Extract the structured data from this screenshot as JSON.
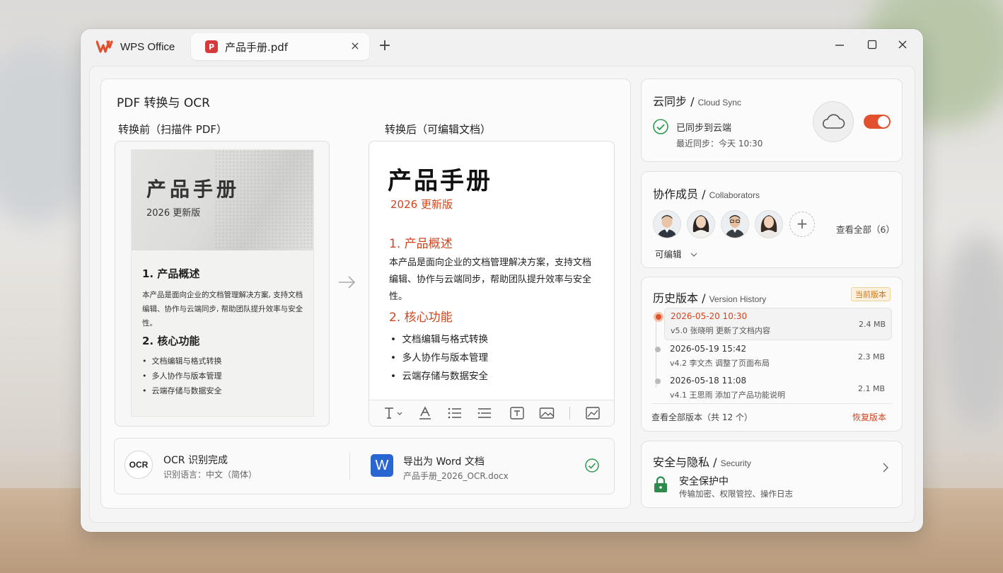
{
  "app": {
    "name": "WPS Office",
    "brand_color": "#e2512d"
  },
  "tab": {
    "label": "产品手册.pdf",
    "icon": "pdf-icon",
    "close_icon": "close-icon"
  },
  "new_tab_label": "+",
  "window_controls": {
    "minimize": "—",
    "maximize": "☐",
    "close": "✕"
  },
  "main": {
    "title": "PDF 转换与 OCR",
    "before_label": "转换前（扫描件 PDF）",
    "after_label": "转换后（可编辑文档）",
    "scan": {
      "title": "产品手册",
      "subtitle": "2026 更新版",
      "h1": "1. 产品概述",
      "p1_line1": "本产品是面向企业的文档管理解决方案, 支持文档",
      "p1_line2": "编辑、协作与云端同步, 帮助团队提升效率与安全性。",
      "h2": "2. 核心功能",
      "items": [
        "文档编辑与格式转换",
        "多人协作与版本管理",
        "云端存储与数据安全"
      ]
    },
    "converted": {
      "title": "产品手册",
      "subtitle": "2026 更新版",
      "h1": "1. 产品概述",
      "p1_line1": "本产品是面向企业的文档管理解决方案，支持文档",
      "p1_line2": "编辑、协作与云端同步，帮助团队提升效率与安全性。",
      "h2": "2. 核心功能",
      "items": [
        "文档编辑与格式转换",
        "多人协作与版本管理",
        "云端存储与数据安全"
      ]
    },
    "ocr": {
      "badge": "OCR",
      "title": "OCR 识别完成",
      "language": "识别语言：中文（简体）"
    },
    "export": {
      "icon_letter": "W",
      "title": "导出为 Word 文档",
      "filename": "产品手册_2026_OCR.docx"
    }
  },
  "sync": {
    "title": "云同步",
    "title_en": "Cloud Sync",
    "status": "已同步到云端",
    "last_sync": "最近同步：今天 10:30",
    "enabled": true
  },
  "collaborators": {
    "title": "协作成员",
    "title_en": "Collaborators",
    "members": [
      "male-avatar",
      "female-avatar",
      "male-avatar",
      "female-avatar"
    ],
    "add_label": "+",
    "view_all": "查看全部（6）",
    "permission": "可编辑"
  },
  "history": {
    "title": "历史版本",
    "title_en": "Version History",
    "current_badge": "当前版本",
    "versions": [
      {
        "date": "2026-05-20   10:30",
        "meta": "v5.0    张晓明    更新了文档内容",
        "size": "2.4 MB"
      },
      {
        "date": "2026-05-19   15:42",
        "meta": "v4.2    李文杰    调整了页面布局",
        "size": "2.3 MB"
      },
      {
        "date": "2026-05-18   11:08",
        "meta": "v4.1    王思雨    添加了产品功能说明",
        "size": "2.1 MB"
      }
    ],
    "view_all": "查看全部版本（共 12 个）",
    "restore": "恢复版本"
  },
  "security": {
    "title": "安全与隐私",
    "title_en": "Security",
    "status": "安全保护中",
    "detail": "传输加密、权限管控、操作日志"
  }
}
